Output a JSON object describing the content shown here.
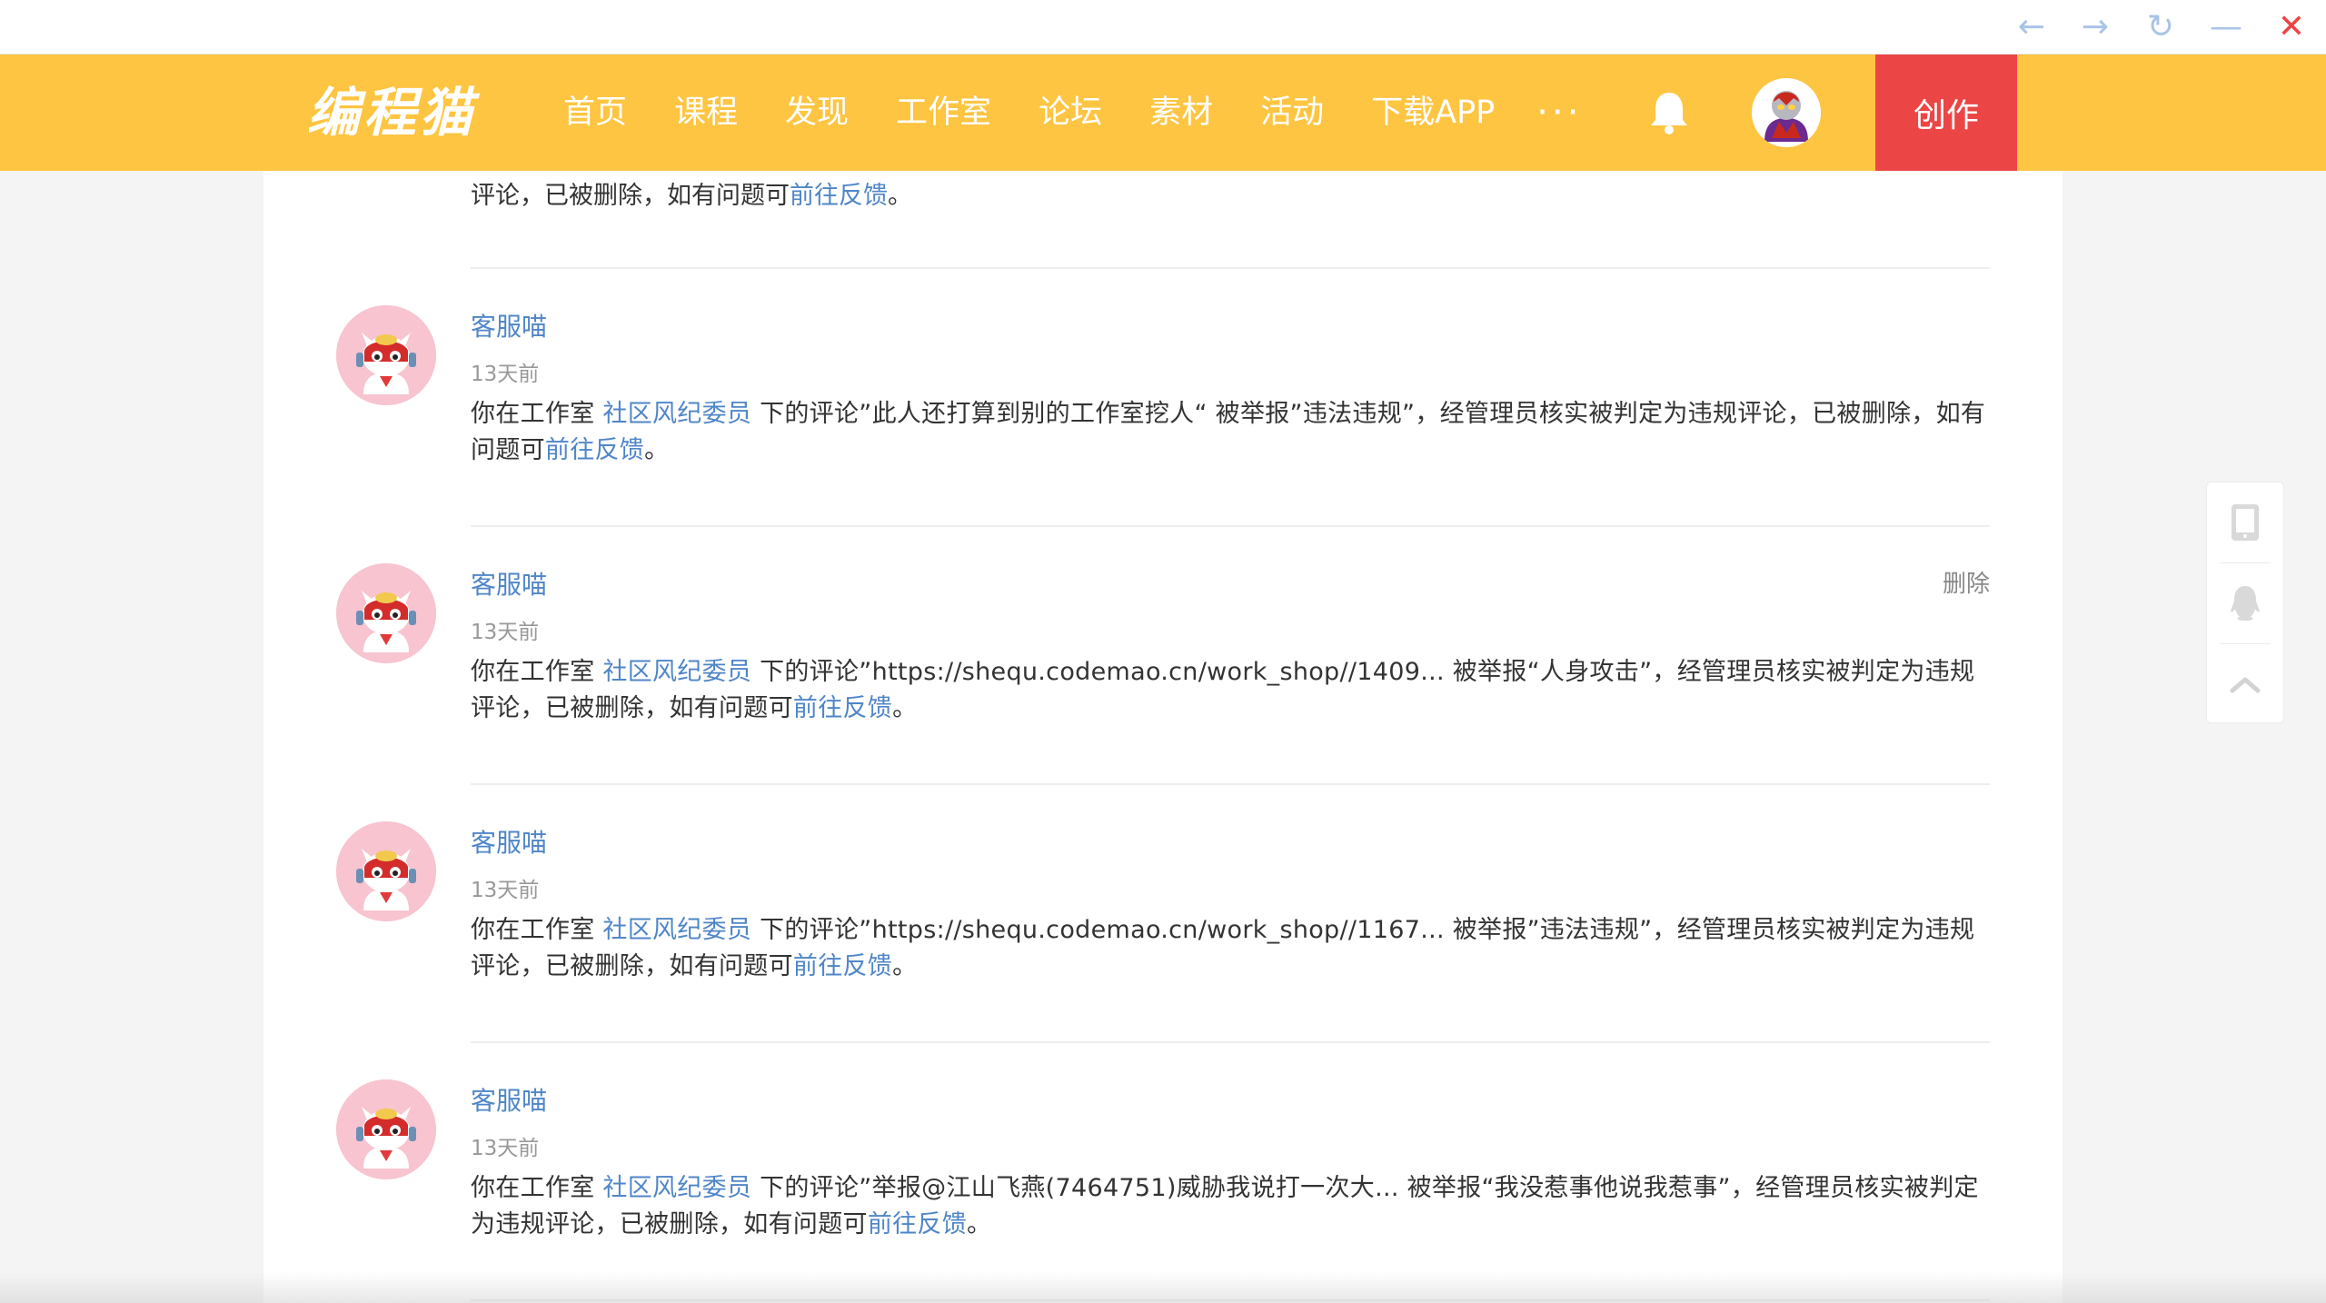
{
  "window_controls": {
    "back": "←",
    "forward": "→",
    "reload": "↻",
    "minimize": "—",
    "close": "✕"
  },
  "header": {
    "logo": "编程猫",
    "nav": [
      "首页",
      "课程",
      "发现",
      "工作室",
      "论坛",
      "素材",
      "活动",
      "下载APP"
    ],
    "more": "···",
    "create_label": "创作",
    "colors": {
      "bar": "#fec542",
      "create": "#ec4545"
    }
  },
  "partial_message": {
    "text_before": "评论，已被删除，如有问题可",
    "link": "前往反馈",
    "text_after": "。"
  },
  "messages": [
    {
      "sender": "客服喵",
      "time": "13天前",
      "prefix": "你在工作室 ",
      "studio": "社区风纪委员",
      "body": " 下的评论”此人还打算到别的工作室挖人“ 被举报”违法违规”，经管理员核实被判定为违规评论，已被删除，如有问题可",
      "link": "前往反馈",
      "suffix": "。",
      "delete_label": ""
    },
    {
      "sender": "客服喵",
      "time": "13天前",
      "prefix": "你在工作室 ",
      "studio": "社区风纪委员",
      "body": " 下的评论”https://shequ.codemao.cn/work_shop//1409... 被举报“人身攻击”，经管理员核实被判定为违规评论，已被删除，如有问题可",
      "link": "前往反馈",
      "suffix": "。",
      "delete_label": "删除"
    },
    {
      "sender": "客服喵",
      "time": "13天前",
      "prefix": "你在工作室 ",
      "studio": "社区风纪委员",
      "body": " 下的评论”https://shequ.codemao.cn/work_shop//1167...  被举报”违法违规”，经管理员核实被判定为违规评论，已被删除，如有问题可",
      "link": "前往反馈",
      "suffix": "。",
      "delete_label": ""
    },
    {
      "sender": "客服喵",
      "time": "13天前",
      "prefix": "你在工作室 ",
      "studio": "社区风纪委员",
      "body": " 下的评论”举报@江山飞燕(7464751)威胁我说打一次大...  被举报“我没惹事他说我惹事”，经管理员核实被判定为违规评论，已被删除，如有问题可",
      "link": "前往反馈",
      "suffix": "。",
      "delete_label": ""
    }
  ],
  "side_tools": [
    "tablet-icon",
    "qq-icon",
    "back-to-top-icon"
  ]
}
